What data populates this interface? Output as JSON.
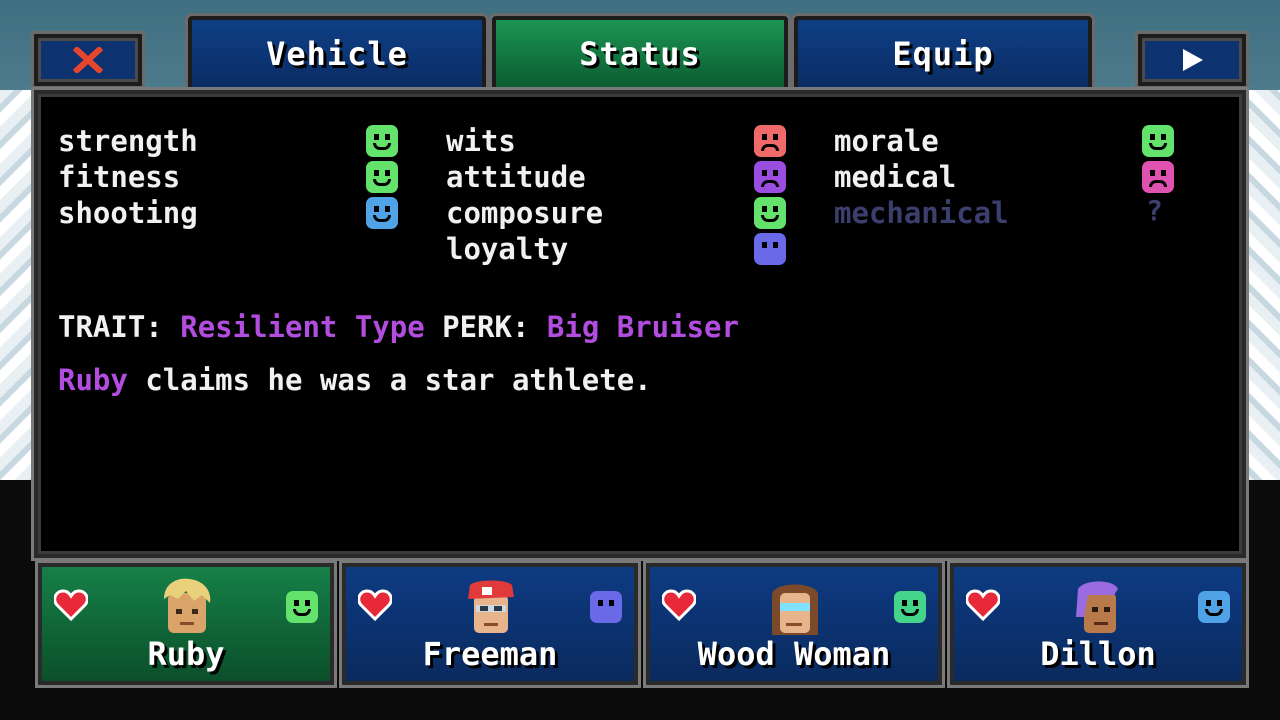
{
  "tabs": {
    "close_icon": "close-x-icon",
    "vehicle": "Vehicle",
    "status": "Status",
    "equip": "Equip",
    "next_icon": "play-arrow-icon"
  },
  "stats": {
    "col1": [
      {
        "label": "strength",
        "mood": "happy",
        "color": "#63e36b"
      },
      {
        "label": "fitness",
        "mood": "happy",
        "color": "#63e36b"
      },
      {
        "label": "shooting",
        "mood": "content",
        "color": "#4fa3e6"
      }
    ],
    "col2": [
      {
        "label": "wits",
        "mood": "angry",
        "color": "#f06a6a"
      },
      {
        "label": "attitude",
        "mood": "sad",
        "color": "#9a4ee0"
      },
      {
        "label": "composure",
        "mood": "happy",
        "color": "#63e36b"
      },
      {
        "label": "loyalty",
        "mood": "neutral",
        "color": "#6a6ae8"
      }
    ],
    "col3": [
      {
        "label": "morale",
        "mood": "happy",
        "color": "#63e36b"
      },
      {
        "label": "medical",
        "mood": "sad",
        "color": "#e052b0"
      },
      {
        "label": "mechanical",
        "mood": "unknown",
        "color": "#3a3f6e",
        "value": "?"
      }
    ]
  },
  "info": {
    "trait_label": "TRAIT:",
    "trait_value": "Resilient Type",
    "perk_label": "PERK:",
    "perk_value": "Big Bruiser",
    "bio_name": "Ruby",
    "bio_text": "claims he was a star athlete."
  },
  "party": [
    {
      "name": "Ruby",
      "active": true,
      "face_color": "#63e36b"
    },
    {
      "name": "Freeman",
      "active": false,
      "face_color": "#6a6ae8"
    },
    {
      "name": "Wood Woman",
      "active": false,
      "face_color": "#44d48a"
    },
    {
      "name": "Dillon",
      "active": false,
      "face_color": "#4fa3e6"
    }
  ]
}
